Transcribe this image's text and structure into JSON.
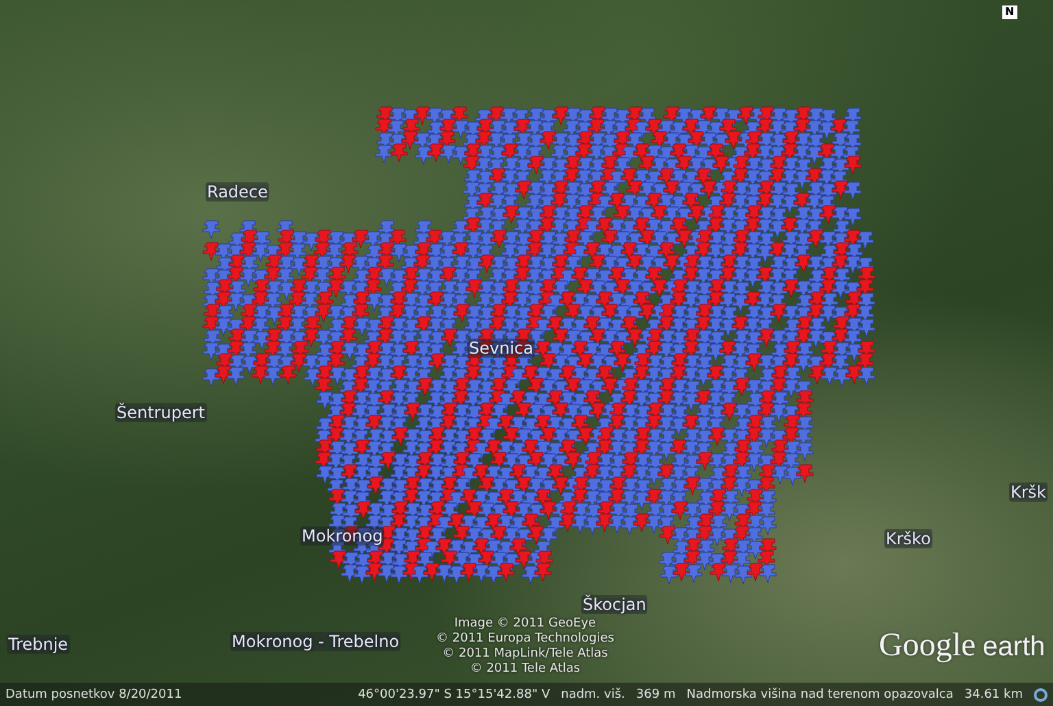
{
  "map": {
    "place_labels": [
      {
        "text": "Radece"
      },
      {
        "text": "Sevnica"
      },
      {
        "text": "Šentrupert"
      },
      {
        "text": "Kršk"
      },
      {
        "text": "Mokronog"
      },
      {
        "text": "Krško"
      },
      {
        "text": "Škocjan"
      },
      {
        "text": "Trebnje"
      },
      {
        "text": "Mokronog - Trebelno"
      }
    ],
    "credits": [
      "Image © 2011 GeoEye",
      "© 2011 Europa Technologies",
      "© 2011 MapLink/Tele Atlas",
      "© 2011 Tele Atlas"
    ],
    "compass": "N",
    "logo": {
      "brand": "Google",
      "product": "earth"
    }
  },
  "status_bar": {
    "imagery_date": "Datum posnetkov 8/20/2011",
    "coordinates": "46°00'23.97\" S  15°15'42.88\" V",
    "elevation_label": "nadm. viš.",
    "elevation": "369 m",
    "eye_alt_label": "Nadmorska višina nad terenom opazovalca",
    "eye_alt": "34.61 km"
  }
}
